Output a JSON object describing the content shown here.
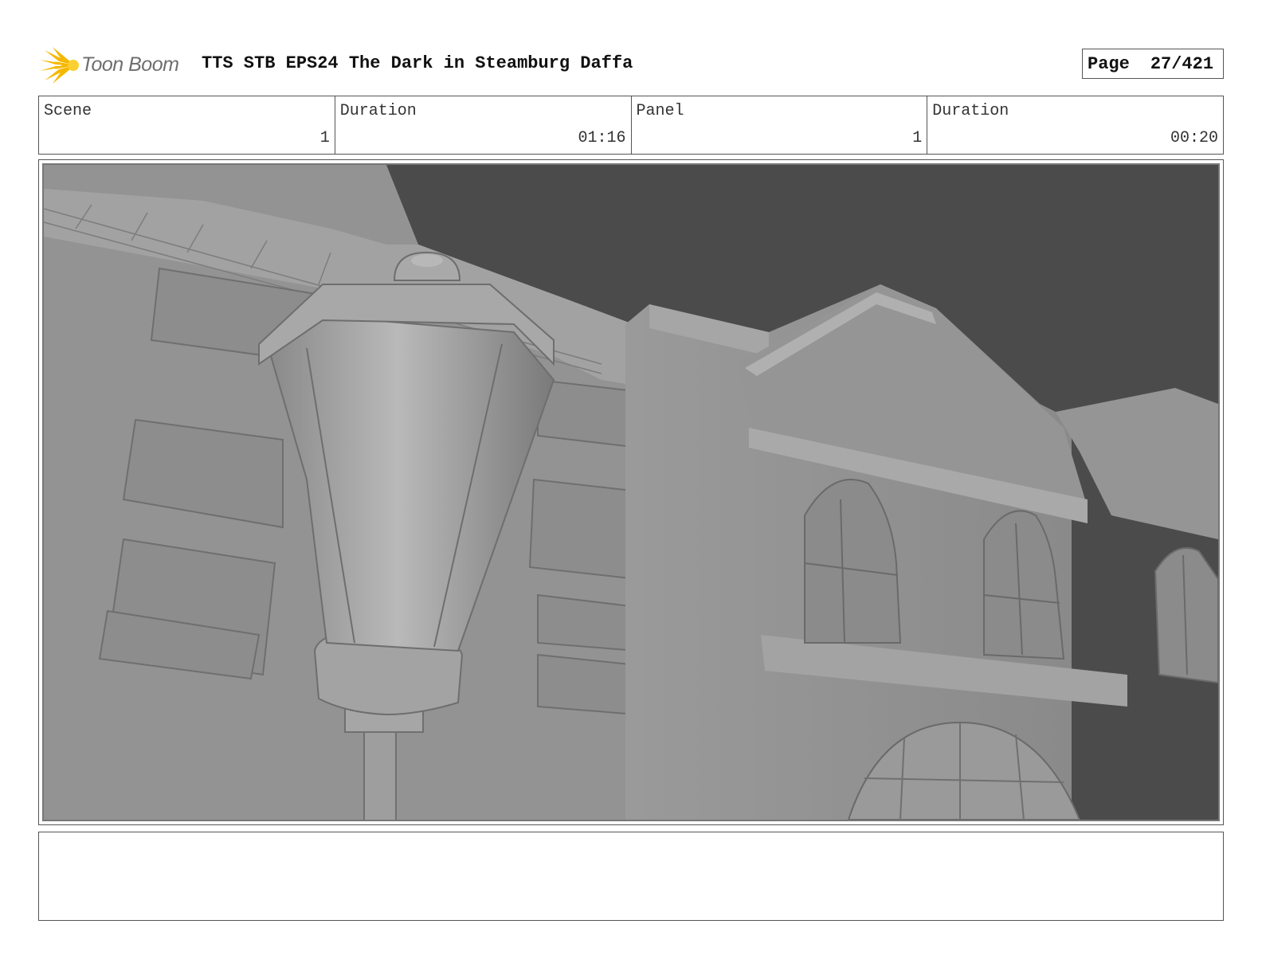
{
  "header": {
    "logo_text": "Toon Boom",
    "title": "TTS STB EPS24 The Dark in Steamburg Daffa",
    "page_label": "Page",
    "page_number": "27/421"
  },
  "info": {
    "scene_label": "Scene",
    "scene_value": "1",
    "scene_duration_label": "Duration",
    "scene_duration_value": "01:16",
    "panel_label": "Panel",
    "panel_value": "1",
    "panel_duration_label": "Duration",
    "panel_duration_value": "00:20"
  },
  "panel": {
    "image_icon": "storyboard-panel-3d-street-lamp-buildings"
  },
  "notes": {
    "text": ""
  },
  "colors": {
    "logo_accent": "#f5b800",
    "sky": "#4a4a4a",
    "wall": "#8e8e8e"
  }
}
